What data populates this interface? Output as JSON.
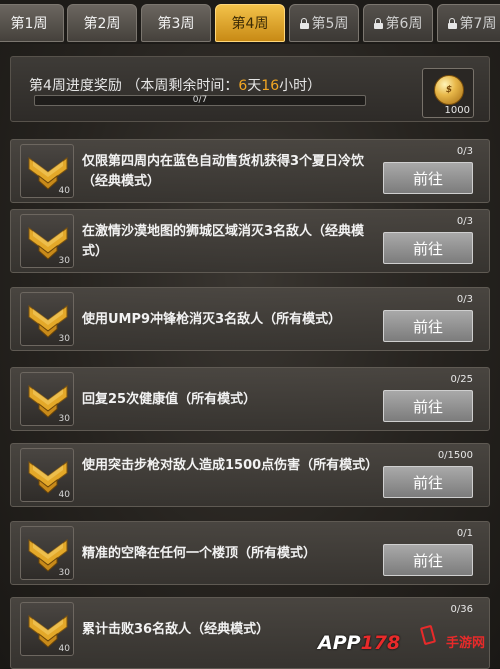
{
  "tabs": [
    {
      "label": "第1周",
      "state": "normal"
    },
    {
      "label": "第2周",
      "state": "normal"
    },
    {
      "label": "第3周",
      "state": "normal"
    },
    {
      "label": "第4周",
      "state": "active"
    },
    {
      "label": "第5周",
      "state": "locked"
    },
    {
      "label": "第6周",
      "state": "locked"
    },
    {
      "label": "第7周",
      "state": "locked"
    }
  ],
  "header": {
    "title_prefix": "第4周进度奖励 （本周剩余时间：",
    "days": "6",
    "day_unit": "天",
    "hours": "16",
    "hour_unit": "小时）",
    "progress_text": "0/7",
    "progress_fraction": 0,
    "reward_icon": "gold-coin-icon",
    "reward_amount": "1000"
  },
  "tasks": [
    {
      "badge_value": "40",
      "description": "仅限第四周内在蓝色自动售货机获得3个夏日冷饮（经典模式）",
      "count": "0/3",
      "button": "前往"
    },
    {
      "badge_value": "30",
      "description": "在激情沙漠地图的狮城区域消灭3名敌人（经典模式）",
      "count": "0/3",
      "button": "前往"
    },
    {
      "badge_value": "30",
      "description": "使用UMP9冲锋枪消灭3名敌人（所有模式）",
      "count": "0/3",
      "button": "前往"
    },
    {
      "badge_value": "30",
      "description": "回复25次健康值（所有模式）",
      "count": "0/25",
      "button": "前往"
    },
    {
      "badge_value": "40",
      "description": "使用突击步枪对敌人造成1500点伤害（所有模式）",
      "count": "0/1500",
      "button": "前往"
    },
    {
      "badge_value": "30",
      "description": "精准的空降在任何一个楼顶（所有模式）",
      "count": "0/1",
      "button": "前往"
    },
    {
      "badge_value": "40",
      "description": "累计击败36名敌人（经典模式）",
      "count": "0/36",
      "button": ""
    }
  ],
  "watermark": {
    "brand": "APP",
    "number": "178",
    "site": "手游网"
  },
  "colors": {
    "accent": "#f2a623",
    "active_tab": "#e0a830",
    "button": "#8f8f8f",
    "watermark_red": "#e82a2a"
  }
}
